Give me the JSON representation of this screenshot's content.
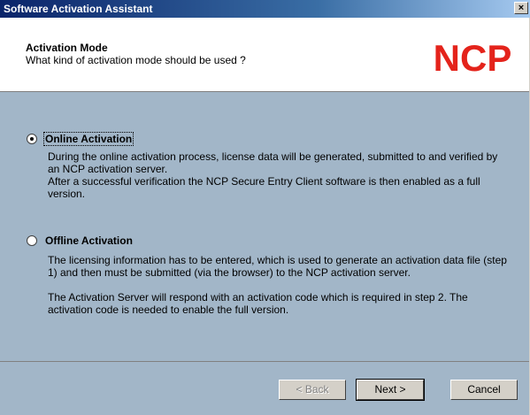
{
  "window": {
    "title": "Software Activation Assistant",
    "close_label": "×"
  },
  "header": {
    "title": "Activation Mode",
    "subtitle": "What kind of activation mode should be used ?",
    "logo_text": "NCP",
    "logo_color": "#e4231b"
  },
  "options": [
    {
      "label": "Online Activation",
      "selected": true,
      "description": [
        "During the online activation process, license data will be generated, submitted to and verified by an NCP activation server.",
        "After a successful verification the NCP Secure Entry Client software is then enabled as a full version."
      ]
    },
    {
      "label": "Offline Activation",
      "selected": false,
      "description": [
        "The licensing information has to be entered, which is used to generate an activation data file (step 1) and then must be submitted (via the browser) to the NCP activation server.",
        "The Activation Server will respond with an activation code which is required in step 2. The activation code is needed to enable the full version."
      ]
    }
  ],
  "buttons": {
    "back": "< Back",
    "next": "Next >",
    "cancel": "Cancel"
  },
  "colors": {
    "content_bg": "#a2b6c8",
    "titlebar": "#0a246a"
  }
}
